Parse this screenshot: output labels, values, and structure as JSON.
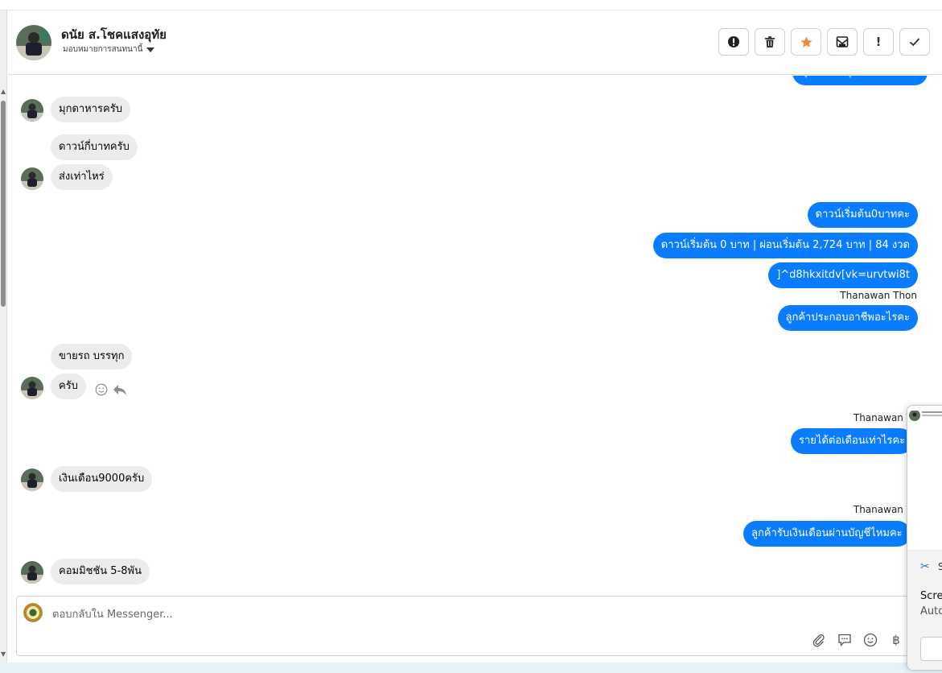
{
  "header": {
    "contact_name": "ดนัย ส.โชคแสงอุทัย",
    "assign_label": "มอบหมายการสนทนานี้",
    "actions": [
      {
        "name": "report-spam-icon"
      },
      {
        "name": "trash-icon"
      },
      {
        "name": "star-icon"
      },
      {
        "name": "mark-unread-icon"
      },
      {
        "name": "important-icon"
      },
      {
        "name": "check-icon"
      }
    ]
  },
  "messages": [
    {
      "dir": "out",
      "text": "มุกดาหารทุกอำเภอครับผม"
    },
    {
      "dir": "in",
      "text": "มุกดาหารครับ"
    },
    {
      "dir": "in",
      "text": "ดาวน์กี่บาทครับ"
    },
    {
      "dir": "in",
      "text": "ส่งเท่าไหร่"
    },
    {
      "dir": "out",
      "text": "ดาวน์เริ่มต้น0บาทคะ"
    },
    {
      "dir": "out",
      "text": "ดาวน์เริ่มต้น 0 บาท | ผ่อนเริ่มต้น 2,724 บาท | 84 งวด"
    },
    {
      "dir": "out",
      "text": "]^d8hkxitdv[vk=urvtwi8t"
    },
    {
      "dir": "out",
      "sender": "Thanawan Thon",
      "text": "ลูกค้าประกอบอาชีพอะไรคะ"
    },
    {
      "dir": "in",
      "text": "ขายรถ บรรทุก"
    },
    {
      "dir": "in",
      "text": "ครับ"
    },
    {
      "dir": "out",
      "sender": "Thanawan Tho",
      "text": "รายได้ต่อเดือนเท่าไรคะ"
    },
    {
      "dir": "in",
      "text": "เงินเดือน9000ครับ"
    },
    {
      "dir": "out",
      "sender": "Thanawan Tho",
      "text": "ลูกค้ารับเงินเดือนผ่านบัญชีไหมคะ"
    },
    {
      "dir": "in",
      "text": "คอมมิชชัน 5-8พัน"
    }
  ],
  "composer": {
    "placeholder": "ตอบกลับใน Messenger...",
    "tools": [
      "paperclip-icon",
      "comment-icon",
      "emoji-icon",
      "baht-icon"
    ]
  },
  "popup": {
    "label": "S",
    "line1": "Scre",
    "line2": "Auto"
  },
  "colors": {
    "outgoing": "#0a7cff",
    "incoming": "#ececec",
    "star": "#f5883b"
  }
}
